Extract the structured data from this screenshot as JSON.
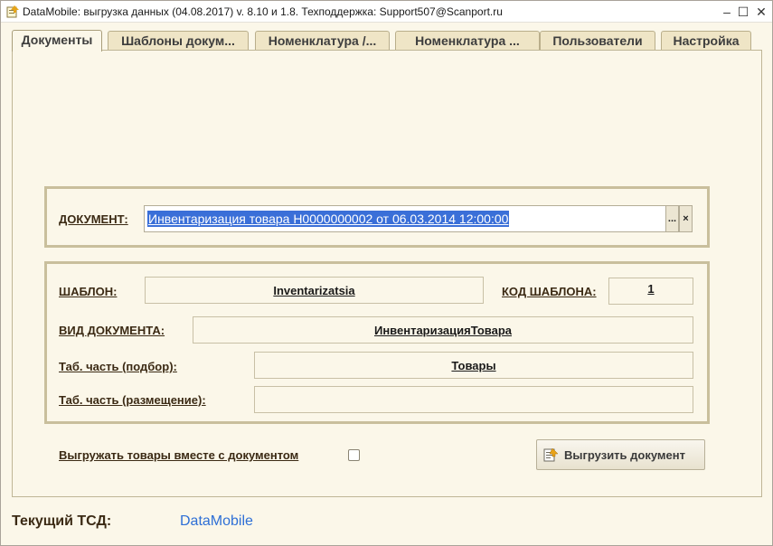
{
  "window": {
    "title": "DataMobile: выгрузка данных (04.08.2017) v. 8.10 и 1.8. Техподдержка: Support507@Scanport.ru",
    "minimize": "–",
    "maximize": "☐",
    "close": "✕"
  },
  "tabs": [
    {
      "label": "Документы",
      "active": true
    },
    {
      "label": "Шаблоны докум...",
      "active": false
    },
    {
      "label": "Номенклатура /...",
      "active": false
    },
    {
      "label": "Номенклатура ...",
      "active": false
    },
    {
      "label": "Пользователи",
      "active": false
    },
    {
      "label": "Настройка",
      "active": false
    }
  ],
  "document": {
    "label": "ДОКУМЕНТ:",
    "value": "Инвентаризация товара Н0000000002 от 06.03.2014 12:00:00",
    "select_btn": "...",
    "clear_btn": "×"
  },
  "template": {
    "template_label": "ШАБЛОН:",
    "template_value": "Inventarizatsia",
    "code_label": "КОД ШАБЛОНА:",
    "code_value": "1",
    "doc_type_label": "ВИД ДОКУМЕНТА:",
    "doc_type_value": "ИнвентаризацияТовара",
    "tab_pick_label": "Таб. часть (подбор):",
    "tab_pick_value": "Товары",
    "tab_place_label": "Таб. часть (размещение):",
    "tab_place_value": ""
  },
  "export": {
    "checkbox_label": "Выгружать товары вместе с документом",
    "checked": false,
    "button_label": "Выгрузить документ"
  },
  "status": {
    "label": "Текущий ТСД:",
    "value": "DataMobile"
  },
  "colors": {
    "accent": "#2e6fd6",
    "selection": "#3a6fd8",
    "background": "#fbf7e9",
    "group_border": "#c9bf9c"
  }
}
